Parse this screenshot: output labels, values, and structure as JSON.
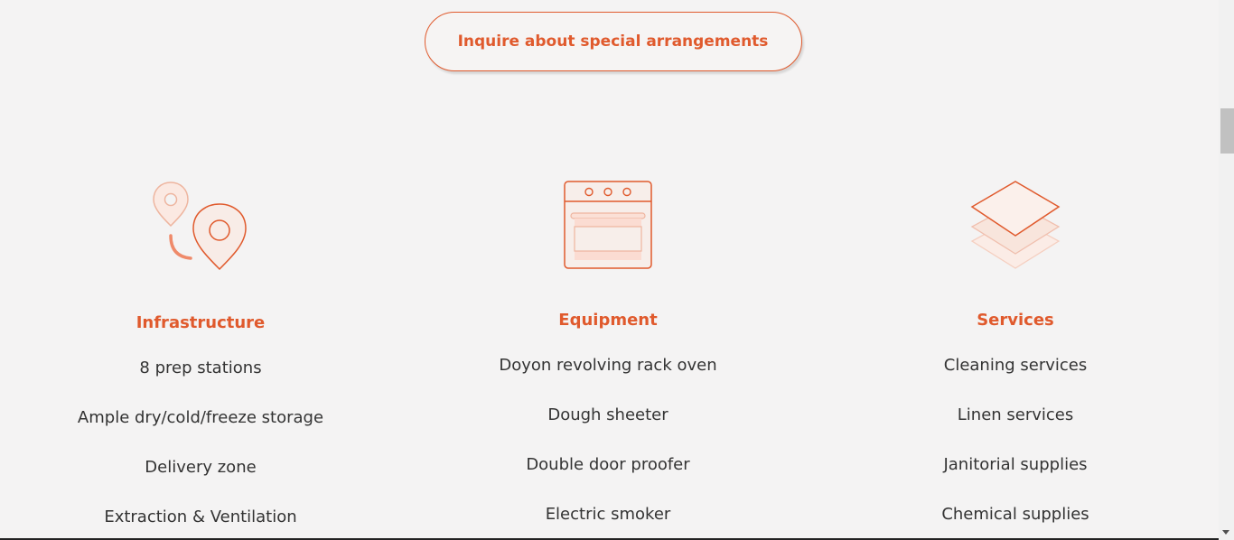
{
  "cta": {
    "label": "Inquire about special arrangements"
  },
  "columns": [
    {
      "icon": "location-pins-icon",
      "title": "Infrastructure",
      "items": [
        "8 prep stations",
        "Ample dry/cold/freeze storage",
        "Delivery zone",
        "Extraction & Ventilation"
      ]
    },
    {
      "icon": "oven-icon",
      "title": "Equipment",
      "items": [
        "Doyon revolving rack oven",
        "Dough sheeter",
        "Double door proofer",
        "Electric smoker"
      ]
    },
    {
      "icon": "layers-icon",
      "title": "Services",
      "items": [
        "Cleaning services",
        "Linen services",
        "Janitorial supplies",
        "Chemical supplies"
      ]
    }
  ],
  "colors": {
    "accent": "#e05a2d",
    "background": "#f4f3f3",
    "text": "#333333"
  }
}
